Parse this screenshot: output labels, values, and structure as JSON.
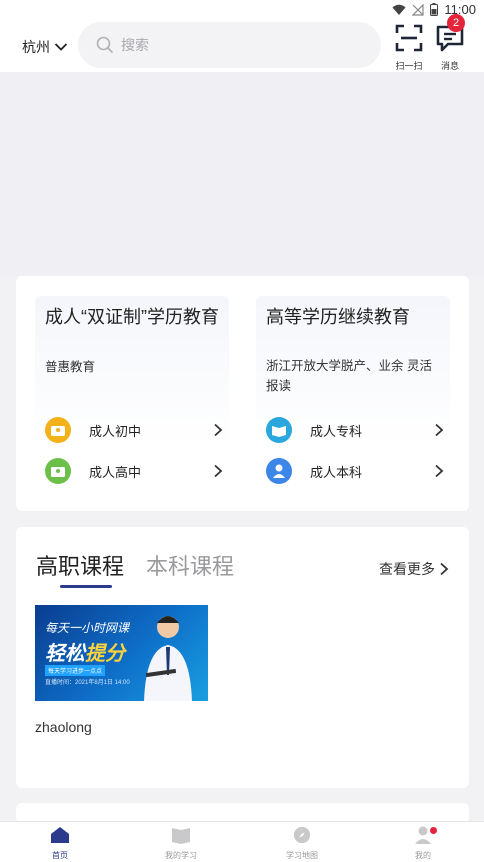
{
  "status_bar": {
    "time": "11:00"
  },
  "header": {
    "city": "杭州",
    "search_placeholder": "搜索",
    "scan_label": "扫一扫",
    "message_label": "消息",
    "message_badge": "2"
  },
  "education": {
    "left": {
      "title": "成人“双证制”学历教育",
      "subtitle": "普惠教育",
      "items": [
        {
          "label": "成人初中",
          "icon": "adult-junior-icon",
          "color": "#f3b21a"
        },
        {
          "label": "成人高中",
          "icon": "adult-senior-icon",
          "color": "#6cc04a"
        }
      ]
    },
    "right": {
      "title": "高等学历继续教育",
      "subtitle": "浙江开放大学脱产、业余 灵活报读",
      "items": [
        {
          "label": "成人专科",
          "icon": "book-icon",
          "color": "#2aa7dc"
        },
        {
          "label": "成人本科",
          "icon": "graduate-icon",
          "color": "#3b86e6"
        }
      ]
    }
  },
  "courses": {
    "tabs": [
      "高职课程",
      "本科课程"
    ],
    "more_label": "查看更多",
    "items": [
      {
        "name": "zhaolong",
        "thumb_line1": "每天一小时网课",
        "thumb_line2a": "轻松",
        "thumb_line2b": "提分",
        "thumb_tag": "每天学习进步一点点",
        "thumb_date": "直播时间：2021年8月1日 14:00"
      }
    ]
  },
  "tabbar": {
    "items": [
      {
        "label": "首页",
        "active": true
      },
      {
        "label": "我的学习",
        "active": false
      },
      {
        "label": "学习地图",
        "active": false
      },
      {
        "label": "我的",
        "active": false
      }
    ]
  },
  "colors": {
    "accent": "#2b3a8c",
    "badge": "#e5233a"
  }
}
